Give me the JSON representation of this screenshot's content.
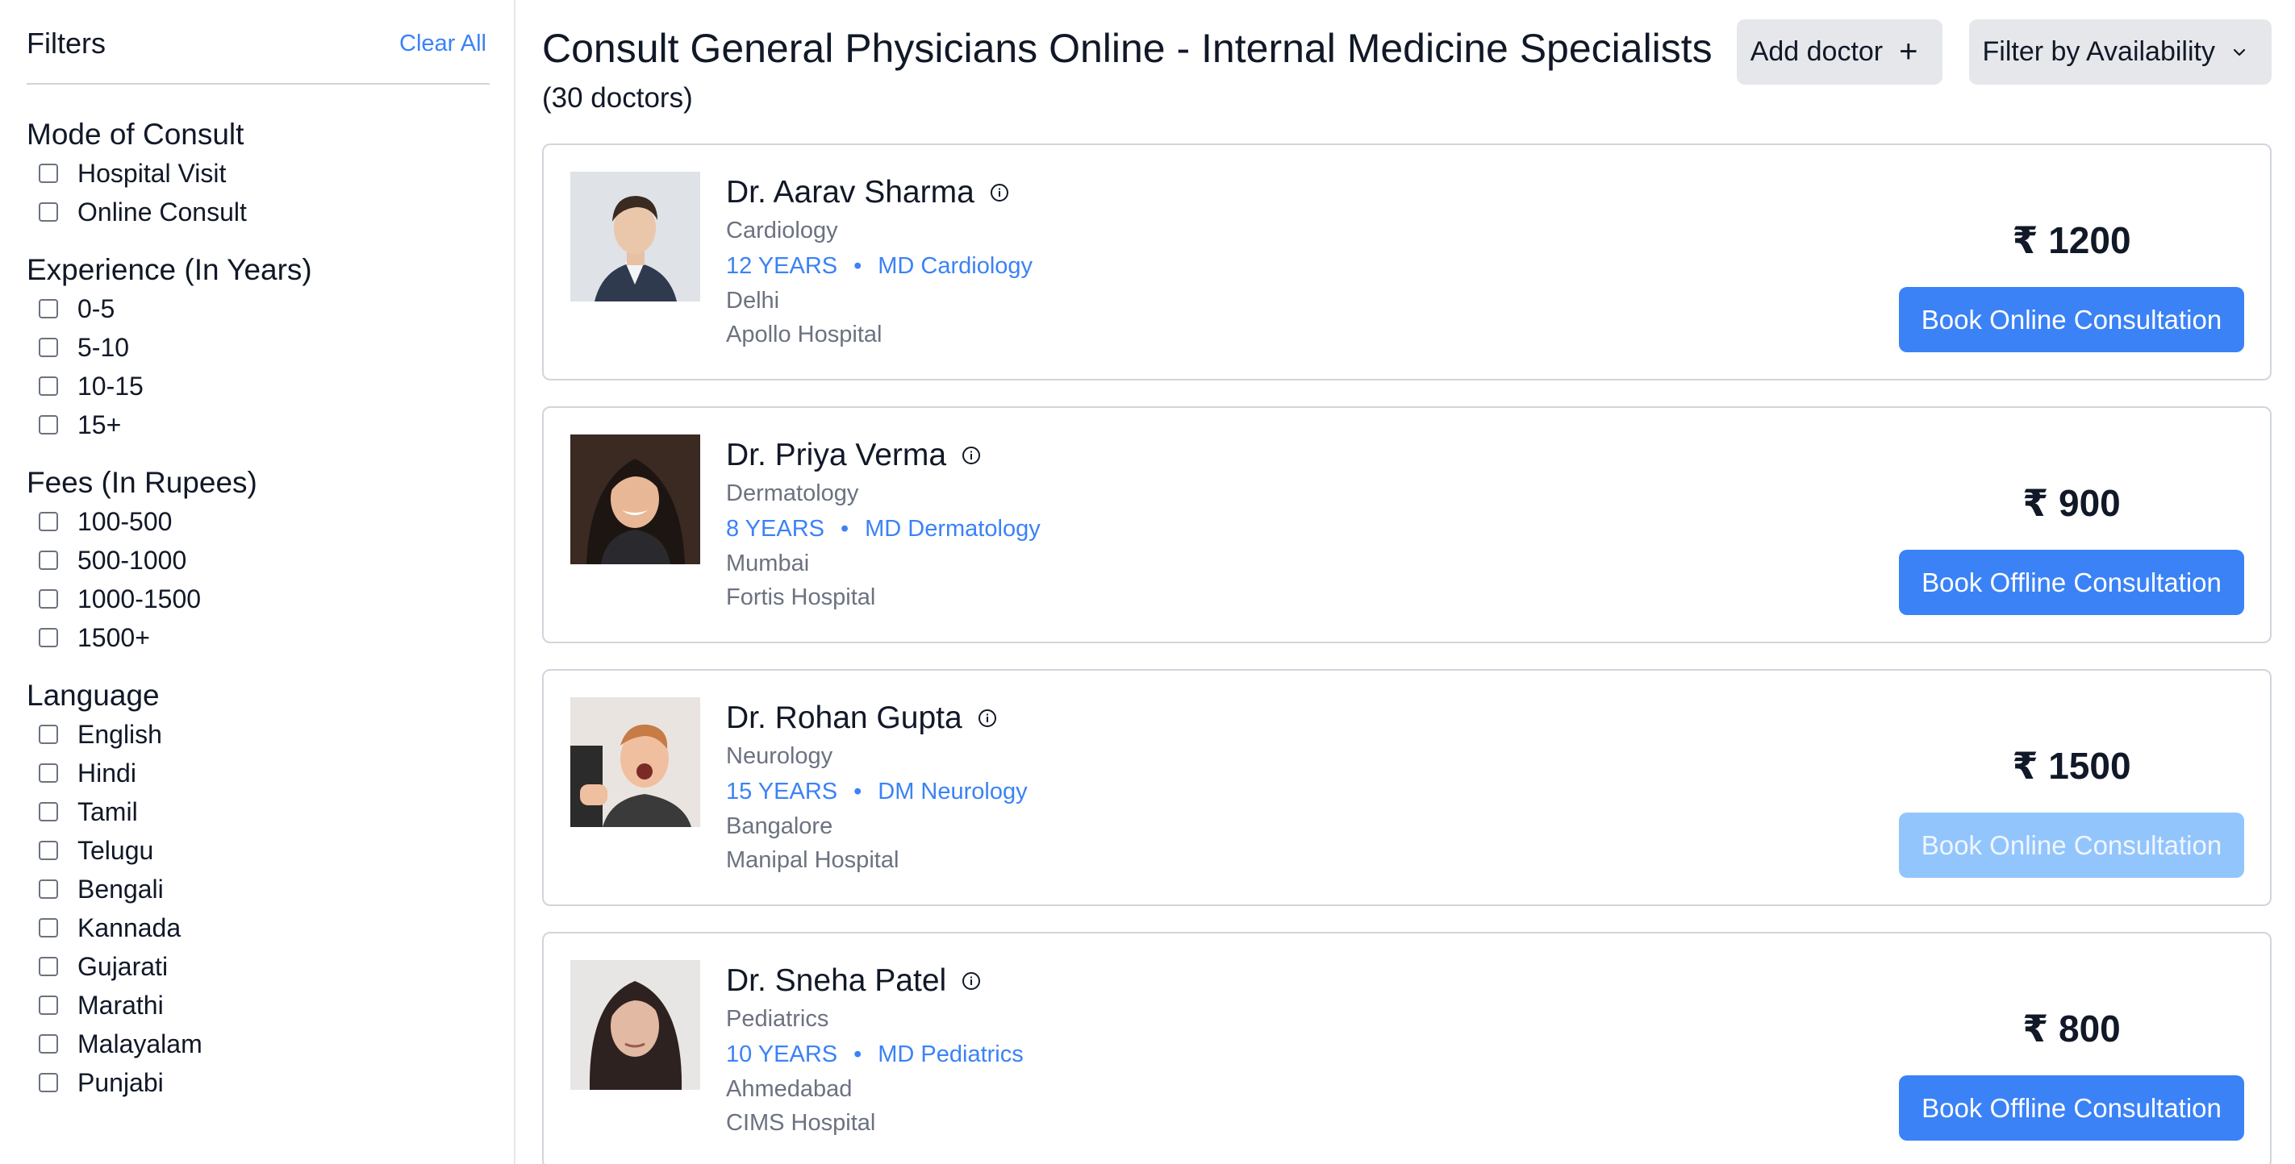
{
  "sidebar": {
    "title": "Filters",
    "clear_all": "Clear All",
    "groups": [
      {
        "title": "Mode of Consult",
        "options": [
          "Hospital Visit",
          "Online Consult"
        ]
      },
      {
        "title": "Experience (In Years)",
        "options": [
          "0-5",
          "5-10",
          "10-15",
          "15+"
        ]
      },
      {
        "title": "Fees (In Rupees)",
        "options": [
          "100-500",
          "500-1000",
          "1000-1500",
          "1500+"
        ]
      },
      {
        "title": "Language",
        "options": [
          "English",
          "Hindi",
          "Tamil",
          "Telugu",
          "Bengali",
          "Kannada",
          "Gujarati",
          "Marathi",
          "Malayalam",
          "Punjabi"
        ]
      }
    ]
  },
  "header": {
    "title": "Consult General Physicians Online - Internal Medicine Specialists",
    "count": "(30 doctors)",
    "add_doctor": "Add doctor",
    "add_glyph": "+",
    "filter_availability": "Filter by Availability"
  },
  "doctors": [
    {
      "name": "Dr. Aarav Sharma",
      "specialty": "Cardiology",
      "experience": "12 YEARS",
      "dot": "•",
      "degree": "MD Cardiology",
      "city": "Delhi",
      "hospital": "Apollo Hospital",
      "price": "₹ 1200",
      "button": "Book Online Consultation",
      "button_disabled": false
    },
    {
      "name": "Dr. Priya Verma",
      "specialty": "Dermatology",
      "experience": "8 YEARS",
      "dot": "•",
      "degree": "MD Dermatology",
      "city": "Mumbai",
      "hospital": "Fortis Hospital",
      "price": "₹ 900",
      "button": "Book Offline Consultation",
      "button_disabled": false
    },
    {
      "name": "Dr. Rohan Gupta",
      "specialty": "Neurology",
      "experience": "15 YEARS",
      "dot": "•",
      "degree": "DM Neurology",
      "city": "Bangalore",
      "hospital": "Manipal Hospital",
      "price": "₹ 1500",
      "button": "Book Online Consultation",
      "button_disabled": true
    },
    {
      "name": "Dr. Sneha Patel",
      "specialty": "Pediatrics",
      "experience": "10 YEARS",
      "dot": "•",
      "degree": "MD Pediatrics",
      "city": "Ahmedabad",
      "hospital": "CIMS Hospital",
      "price": "₹ 800",
      "button": "Book Offline Consultation",
      "button_disabled": false
    }
  ],
  "colors": {
    "accent": "#3b82f6",
    "accent_disabled": "#93c5fd",
    "muted_text": "#6b7280",
    "button_gray": "#e5e7eb"
  }
}
